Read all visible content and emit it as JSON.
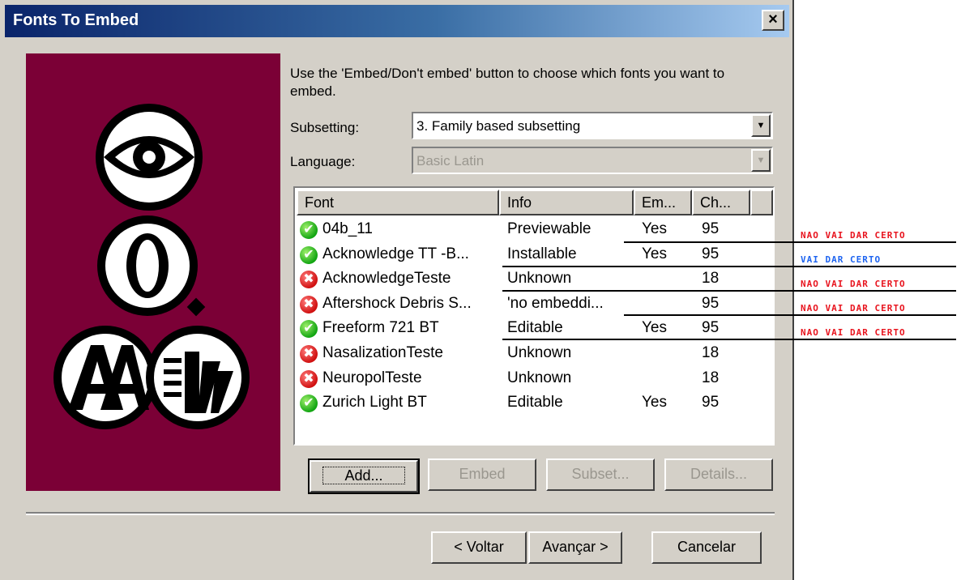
{
  "window": {
    "title": "Fonts To Embed",
    "close_label": "×"
  },
  "instruction": "Use the 'Embed/Don't embed' button to choose which fonts you want to embed.",
  "subsetting": {
    "label": "Subsetting:",
    "value": "3. Family based subsetting"
  },
  "language": {
    "label": "Language:",
    "value": "Basic Latin"
  },
  "table": {
    "columns": [
      "Font",
      "Info",
      "Em...",
      "Ch..."
    ],
    "rows": [
      {
        "status": "ok",
        "font": "04b_11",
        "info": "Previewable",
        "embed": "Yes",
        "chars": "95"
      },
      {
        "status": "ok",
        "font": "Acknowledge TT -B...",
        "info": "Installable",
        "embed": "Yes",
        "chars": "95"
      },
      {
        "status": "bad",
        "font": "AcknowledgeTeste",
        "info": "Unknown",
        "embed": "",
        "chars": "18"
      },
      {
        "status": "bad",
        "font": "Aftershock Debris S...",
        "info": "'no embeddi...",
        "embed": "",
        "chars": "95"
      },
      {
        "status": "ok",
        "font": "Freeform 721 BT",
        "info": "Editable",
        "embed": "Yes",
        "chars": "95"
      },
      {
        "status": "bad",
        "font": "NasalizationTeste",
        "info": "Unknown",
        "embed": "",
        "chars": "18"
      },
      {
        "status": "bad",
        "font": "NeuropolTeste",
        "info": "Unknown",
        "embed": "",
        "chars": "18"
      },
      {
        "status": "ok",
        "font": "Zurich Light BT",
        "info": "Editable",
        "embed": "Yes",
        "chars": "95"
      }
    ]
  },
  "buttons": {
    "add": "Add...",
    "embed": "Embed",
    "subset": "Subset...",
    "details": "Details...",
    "back": "< Voltar",
    "next": "Avançar >",
    "cancel": "Cancelar"
  },
  "annotations": [
    {
      "text": "NAO VAI DAR CERTO",
      "color": "#e8141e"
    },
    {
      "text": "VAI DAR CERTO",
      "color": "#1e64f0"
    },
    {
      "text": "NAO VAI DAR CERTO",
      "color": "#e8141e"
    },
    {
      "text": "NAO VAI DAR CERTO",
      "color": "#e8141e"
    },
    {
      "text": "NAO VAI DAR CERTO",
      "color": "#e8141e"
    }
  ],
  "colors": {
    "logo_bg": "#7b0036",
    "dialog_bg": "#d4d0c8",
    "title_start": "#0a246a",
    "title_end": "#a6caf0"
  },
  "icons": [
    "check-icon",
    "cross-icon",
    "eye-logo-icon",
    "font-logo-icon"
  ]
}
